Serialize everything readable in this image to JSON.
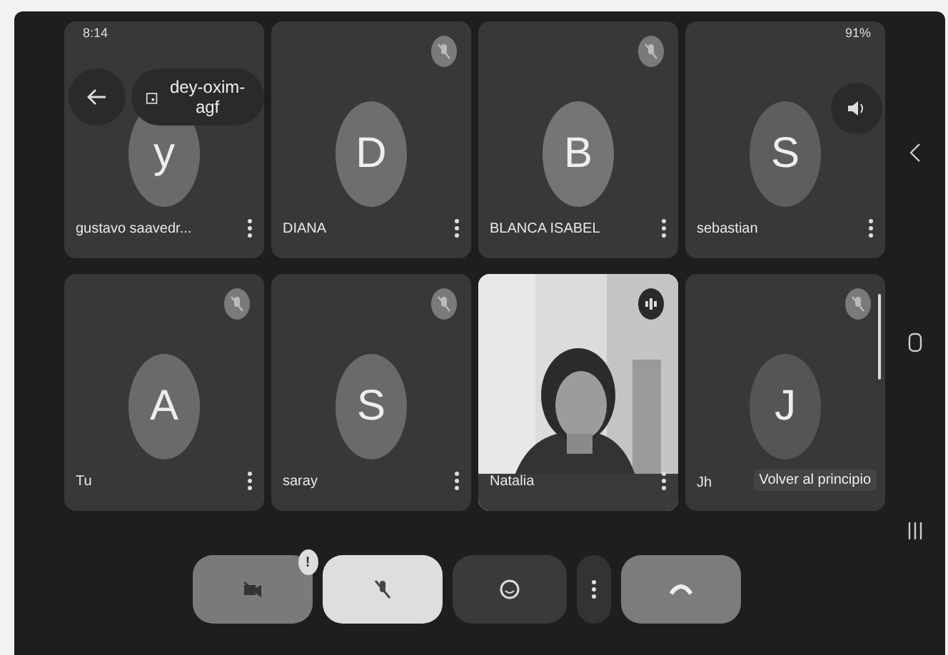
{
  "status_bar": {
    "time": "8:14",
    "battery": "91%"
  },
  "meeting": {
    "code": "dey-oxim-agf"
  },
  "participants": [
    {
      "kind": "avatar",
      "name": "gustavo saavedr...",
      "initial": "y"
    },
    {
      "kind": "avatar",
      "name": "DIANA",
      "initial": "D",
      "muted": true
    },
    {
      "kind": "avatar",
      "name": "BLANCA ISABEL",
      "initial": "B",
      "muted": true
    },
    {
      "kind": "avatar",
      "name": "sebastian",
      "initial": "S"
    },
    {
      "kind": "avatar",
      "name": "Tu",
      "initial": "A",
      "muted": true
    },
    {
      "kind": "avatar",
      "name": "saray",
      "initial": "S",
      "muted": true
    },
    {
      "kind": "picture",
      "name": "Natalia",
      "speaking": true
    },
    {
      "kind": "avatar",
      "name": "Jh",
      "initial": "J",
      "muted": true,
      "tooltip": "Volver al principio"
    }
  ],
  "controls": [
    {
      "kind": "camera",
      "on": false,
      "badge": "!"
    },
    {
      "kind": "mic",
      "on": false
    },
    {
      "kind": "reactions"
    },
    {
      "kind": "more"
    },
    {
      "kind": "hangup"
    }
  ]
}
